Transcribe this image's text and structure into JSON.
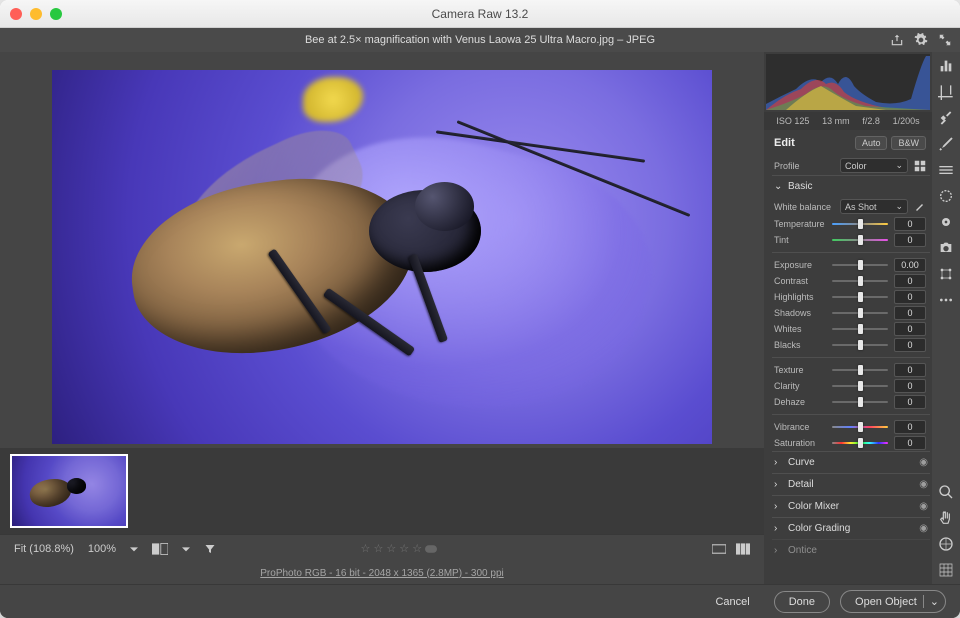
{
  "window_title": "Camera Raw 13.2",
  "filename": "Bee at 2.5× magnification with Venus Laowa 25 Ultra Macro.jpg  –  JPEG",
  "camera": {
    "iso": "ISO 125",
    "focal": "13 mm",
    "aperture": "f/2.8",
    "shutter": "1/200s"
  },
  "edit_panel": {
    "title": "Edit",
    "auto": "Auto",
    "bw": "B&W",
    "profile_label": "Profile",
    "profile_value": "Color",
    "sections": {
      "basic": "Basic",
      "curve": "Curve",
      "detail": "Detail",
      "color_mixer": "Color Mixer",
      "color_grading": "Color Grading",
      "optics": "Ontice"
    },
    "wb_label": "White balance",
    "wb_value": "As Shot",
    "sliders": {
      "temperature": {
        "label": "Temperature",
        "value": "0"
      },
      "tint": {
        "label": "Tint",
        "value": "0"
      },
      "exposure": {
        "label": "Exposure",
        "value": "0.00"
      },
      "contrast": {
        "label": "Contrast",
        "value": "0"
      },
      "highlights": {
        "label": "Highlights",
        "value": "0"
      },
      "shadows": {
        "label": "Shadows",
        "value": "0"
      },
      "whites": {
        "label": "Whites",
        "value": "0"
      },
      "blacks": {
        "label": "Blacks",
        "value": "0"
      },
      "texture": {
        "label": "Texture",
        "value": "0"
      },
      "clarity": {
        "label": "Clarity",
        "value": "0"
      },
      "dehaze": {
        "label": "Dehaze",
        "value": "0"
      },
      "vibrance": {
        "label": "Vibrance",
        "value": "0"
      },
      "saturation": {
        "label": "Saturation",
        "value": "0"
      }
    }
  },
  "viewbar": {
    "fit": "Fit (108.8%)",
    "hundred": "100%"
  },
  "infobar": "ProPhoto RGB - 16 bit - 2048 x 1365 (2.8MP) - 300 ppi",
  "footer": {
    "cancel": "Cancel",
    "done": "Done",
    "open": "Open Object"
  },
  "stars": "☆ ☆ ☆ ☆ ☆"
}
